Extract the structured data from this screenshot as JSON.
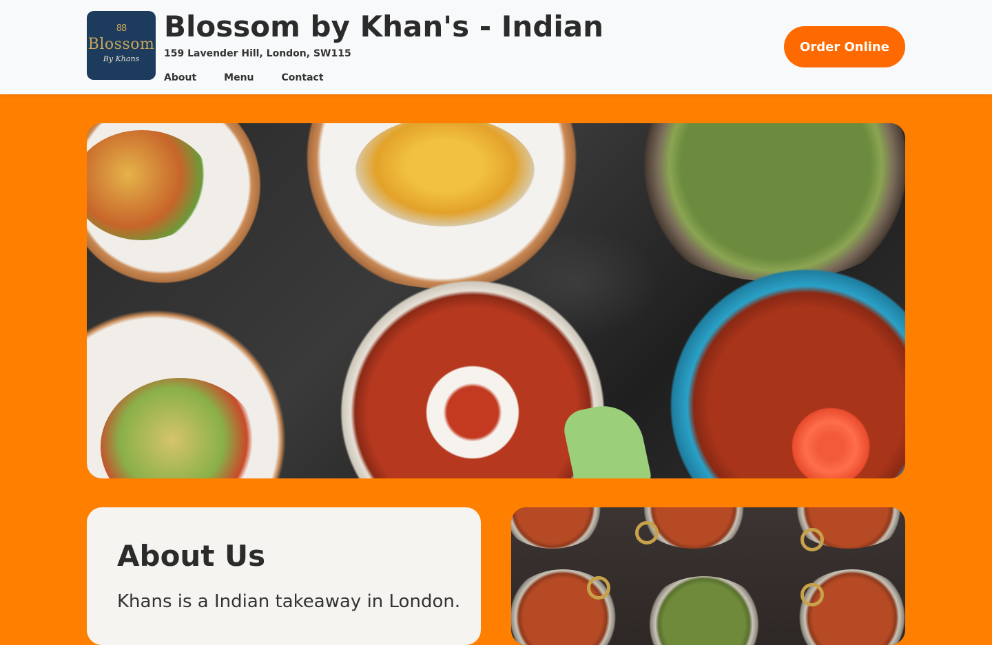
{
  "header": {
    "logo": {
      "mark": "88",
      "word": "Blossom",
      "sub": "By Khans"
    },
    "title": "Blossom by Khan's - Indian",
    "address": "159 Lavender Hill, London, SW115",
    "nav": [
      {
        "label": "About"
      },
      {
        "label": "Menu"
      },
      {
        "label": "Contact"
      }
    ],
    "order_label": "Order Online"
  },
  "about": {
    "heading": "About Us",
    "text": "Khans is a Indian takeaway in London."
  },
  "colors": {
    "page_bg": "#ff8000",
    "order_button": "#ff6a00",
    "logo_bg": "#1d3b5c",
    "logo_gold": "#c9a659"
  }
}
